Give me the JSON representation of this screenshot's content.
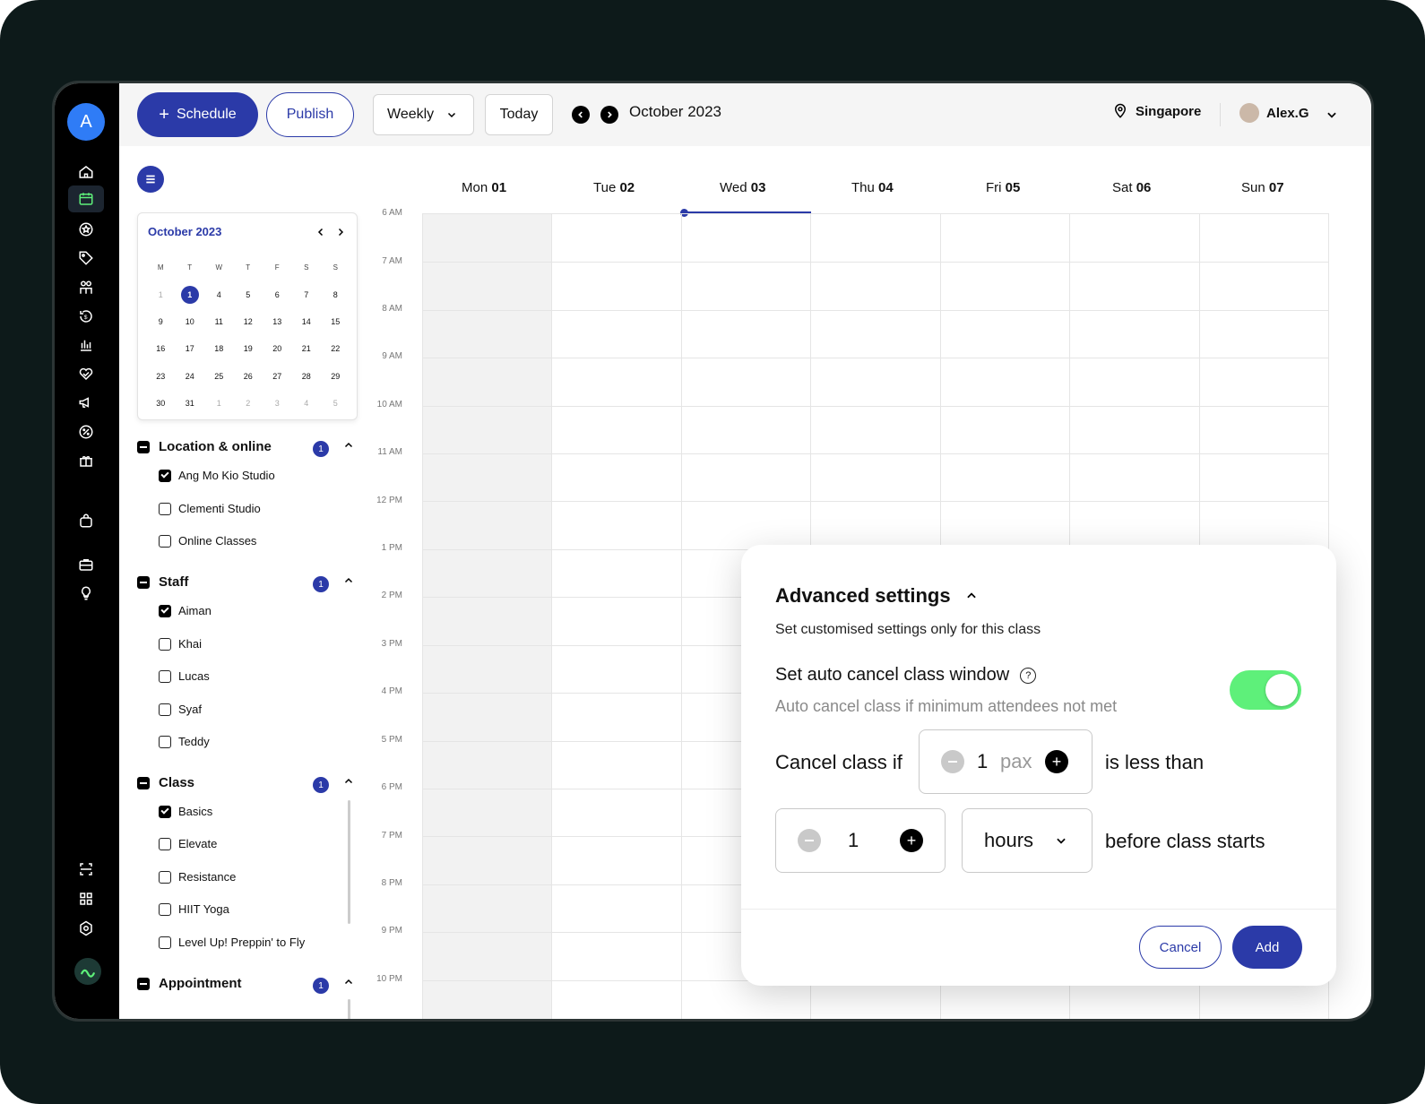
{
  "rail": {
    "avatar_letter": "A",
    "icons": [
      "home-icon",
      "calendar-icon",
      "star-badge-icon",
      "tag-icon",
      "people-icon",
      "refund-icon",
      "bar-chart-icon",
      "handshake-icon",
      "megaphone-icon",
      "percent-icon",
      "gift-icon",
      "bag-icon",
      "briefcase-icon",
      "lightbulb-icon",
      "scan-icon",
      "grid-icon",
      "settings-icon"
    ]
  },
  "topbar": {
    "schedule_label": "Schedule",
    "publish_label": "Publish",
    "view_select": "Weekly",
    "today_label": "Today",
    "current_month": "October 2023",
    "location": "Singapore",
    "user_name": "Alex.G"
  },
  "minical": {
    "title": "October 2023",
    "weekdays": [
      "M",
      "T",
      "W",
      "T",
      "F",
      "S",
      "S"
    ],
    "weeks": [
      [
        "1",
        "1",
        "4",
        "5",
        "6",
        "7",
        "8"
      ],
      [
        "9",
        "10",
        "11",
        "12",
        "13",
        "14",
        "15"
      ],
      [
        "16",
        "17",
        "18",
        "19",
        "20",
        "21",
        "22"
      ],
      [
        "23",
        "24",
        "25",
        "26",
        "27",
        "28",
        "29"
      ],
      [
        "30",
        "31",
        "1",
        "2",
        "3",
        "4",
        "5"
      ]
    ],
    "selected": "1"
  },
  "filters": {
    "location": {
      "title": "Location & online",
      "count": "1",
      "items": [
        "Ang Mo Kio Studio",
        "Clementi Studio",
        "Online Classes"
      ]
    },
    "staff": {
      "title": "Staff",
      "count": "1",
      "items": [
        "Aiman",
        "Khai",
        "Lucas",
        "Syaf",
        "Teddy"
      ]
    },
    "class": {
      "title": "Class",
      "count": "1",
      "items": [
        "Basics",
        "Elevate",
        "Resistance",
        "HIIT Yoga",
        "Level Up! Preppin' to Fly"
      ]
    },
    "appointment": {
      "title": "Appointment",
      "count": "1"
    }
  },
  "calendar": {
    "days": [
      {
        "name": "Mon",
        "num": "01"
      },
      {
        "name": "Tue",
        "num": "02"
      },
      {
        "name": "Wed",
        "num": "03"
      },
      {
        "name": "Thu",
        "num": "04"
      },
      {
        "name": "Fri",
        "num": "05"
      },
      {
        "name": "Sat",
        "num": "06"
      },
      {
        "name": "Sun",
        "num": "07"
      }
    ],
    "times": [
      "6 AM",
      "7 AM",
      "8 AM",
      "9 AM",
      "10 AM",
      "11 AM",
      "12 PM",
      "1 PM",
      "2 PM",
      "3 PM",
      "4 PM",
      "5 PM",
      "6 PM",
      "7 PM",
      "8 PM",
      "9 PM",
      "10 PM"
    ]
  },
  "modal": {
    "title": "Advanced settings",
    "subtitle": "Set customised settings only for this class",
    "auto_cancel_title": "Set auto cancel class window",
    "auto_cancel_desc": "Auto cancel class if minimum attendees not met",
    "toggle_on": true,
    "cancel_if_label": "Cancel class if",
    "pax_value": "1",
    "pax_unit": "pax",
    "less_than_label": "is less than",
    "hours_value": "1",
    "hours_unit": "hours",
    "before_label": "before class starts",
    "cancel_button": "Cancel",
    "add_button": "Add"
  },
  "colors": {
    "primary": "#2b3aa8",
    "toggle": "#5ef07a"
  }
}
